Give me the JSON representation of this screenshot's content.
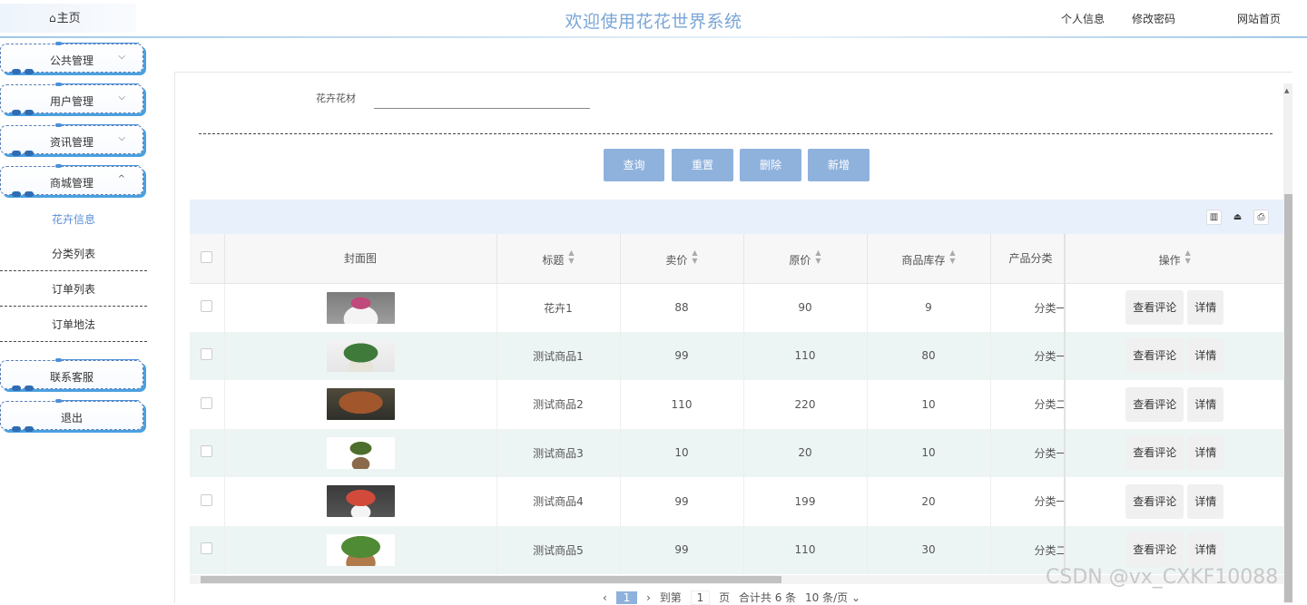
{
  "header": {
    "home_label": "主页",
    "title": "欢迎使用花花世界系统",
    "nav": [
      "个人信息",
      "修改密码",
      "网站首页"
    ]
  },
  "sidebar": {
    "menus": [
      {
        "label": "公共管理",
        "chevron": "⌵"
      },
      {
        "label": "用户管理",
        "chevron": "⌵"
      },
      {
        "label": "资讯管理",
        "chevron": "⌵"
      },
      {
        "label": "商城管理",
        "chevron": "^"
      }
    ],
    "submenu": [
      "花卉信息",
      "分类列表",
      "订单列表",
      "订单地法"
    ],
    "bottom_menus": [
      "联系客服",
      "退出"
    ]
  },
  "search": {
    "label": "花卉花材",
    "value": ""
  },
  "buttons": {
    "query": "查询",
    "reset": "重置",
    "delete": "删除",
    "add": "新增"
  },
  "toolbar_icons": [
    "columns-icon",
    "export-icon",
    "print-icon"
  ],
  "table": {
    "columns": [
      "封面图",
      "标题",
      "卖价",
      "原价",
      "商品库存",
      "产品分类",
      "操作"
    ],
    "rows": [
      {
        "title": "花卉1",
        "price": "88",
        "orig": "90",
        "stock": "9",
        "cat": "分类一"
      },
      {
        "title": "测试商品1",
        "price": "99",
        "orig": "110",
        "stock": "80",
        "cat": "分类一"
      },
      {
        "title": "测试商品2",
        "price": "110",
        "orig": "220",
        "stock": "10",
        "cat": "分类二"
      },
      {
        "title": "测试商品3",
        "price": "10",
        "orig": "20",
        "stock": "10",
        "cat": "分类一"
      },
      {
        "title": "测试商品4",
        "price": "99",
        "orig": "199",
        "stock": "20",
        "cat": "分类一"
      },
      {
        "title": "测试商品5",
        "price": "99",
        "orig": "110",
        "stock": "30",
        "cat": "分类二"
      }
    ],
    "op_comment": "查看评论",
    "op_detail": "详情"
  },
  "pager": {
    "current": "1",
    "goto_label": "到第",
    "goto_value": "1",
    "page_label": "页",
    "total": "合计共 6 条",
    "per_page": "10 条/页 ⌄"
  },
  "watermark": "CSDN @vx_CXKF10088",
  "colors": {
    "accent": "#8fb2dd",
    "title": "#7aa6d6",
    "active_menu": "#5b8fd6"
  }
}
